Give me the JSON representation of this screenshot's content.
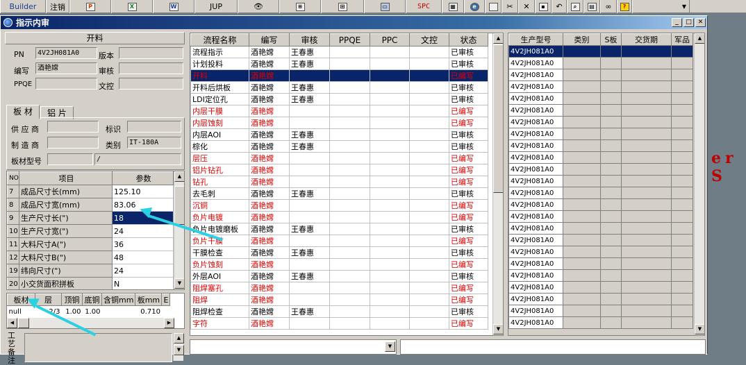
{
  "toolbar": {
    "builder": "Builder",
    "register": "注销",
    "jup": "JUP",
    "spc": "SPC"
  },
  "window": {
    "title": "指示内审"
  },
  "left": {
    "section_title": "开料",
    "pn_label": "PN",
    "pn_value": "4V2JH081A0",
    "version_label": "版本",
    "author_label": "编写",
    "author_value": "酒艳嫦",
    "review_label": "审核",
    "ppqe_label": "PPQE",
    "doc_control_label": "文控",
    "tab_board": "板 材",
    "tab_copper": "铝 片",
    "supplier_label": "供 应 商",
    "mark_label": "标识",
    "manufacturer_label": "制 造 商",
    "category_label": "类别",
    "category_value": "IT-180A",
    "board_model_label": "板材型号",
    "board_model_suffix": "/"
  },
  "params": {
    "headers": [
      "NO",
      "项目",
      "参数"
    ],
    "rows": [
      {
        "no": "7",
        "item": "成品尺寸长(mm)",
        "value": "125.10"
      },
      {
        "no": "8",
        "item": "成品尺寸宽(mm)",
        "value": "83.06"
      },
      {
        "no": "9",
        "item": "生产尺寸长(\")",
        "value": "18",
        "selected": true
      },
      {
        "no": "10",
        "item": "生产尺寸宽(\")",
        "value": "24"
      },
      {
        "no": "11",
        "item": "大料尺寸A(\")",
        "value": "36"
      },
      {
        "no": "12",
        "item": "大料尺寸B(\")",
        "value": "48"
      },
      {
        "no": "19",
        "item": "纬向尺寸(\")",
        "value": "24"
      },
      {
        "no": "20",
        "item": "小交货面积拼板",
        "value": "N"
      }
    ]
  },
  "layers": {
    "headers": [
      "板材",
      "层",
      "顶铜",
      "底铜",
      "含铜mm",
      "板mm",
      "E"
    ],
    "row": [
      "null",
      "2/3",
      "1.00",
      "1.00",
      "",
      "0.710",
      ""
    ]
  },
  "remark": {
    "label": "工艺备注"
  },
  "process": {
    "headers": [
      "流程名称",
      "编写",
      "审核",
      "PPQE",
      "PPC",
      "文控",
      "状态"
    ],
    "rows": [
      {
        "name": "流程指示",
        "author": "酒艳嫦",
        "reviewer": "王春惠",
        "status": "已审核",
        "red": false
      },
      {
        "name": "计划投料",
        "author": "酒艳嫦",
        "reviewer": "王春惠",
        "status": "已审核",
        "red": false
      },
      {
        "name": "开料",
        "author": "酒艳嫦",
        "reviewer": "",
        "status": "已编写",
        "red": true,
        "selected": true
      },
      {
        "name": "开料后烘板",
        "author": "酒艳嫦",
        "reviewer": "王春惠",
        "status": "已审核",
        "red": false
      },
      {
        "name": "LDI定位孔",
        "author": "酒艳嫦",
        "reviewer": "王春惠",
        "status": "已审核",
        "red": false
      },
      {
        "name": "内层干膜",
        "author": "酒艳嫦",
        "reviewer": "",
        "status": "已编写",
        "red": true
      },
      {
        "name": "内层蚀刻",
        "author": "酒艳嫦",
        "reviewer": "",
        "status": "已编写",
        "red": true
      },
      {
        "name": "内层AOI",
        "author": "酒艳嫦",
        "reviewer": "王春惠",
        "status": "已审核",
        "red": false
      },
      {
        "name": "棕化",
        "author": "酒艳嫦",
        "reviewer": "王春惠",
        "status": "已审核",
        "red": false
      },
      {
        "name": "层压",
        "author": "酒艳嫦",
        "reviewer": "",
        "status": "已编写",
        "red": true
      },
      {
        "name": "铝片钻孔",
        "author": "酒艳嫦",
        "reviewer": "",
        "status": "已编写",
        "red": true
      },
      {
        "name": "钻孔",
        "author": "酒艳嫦",
        "reviewer": "",
        "status": "已编写",
        "red": true
      },
      {
        "name": "去毛刺",
        "author": "酒艳嫦",
        "reviewer": "王春惠",
        "status": "已审核",
        "red": false
      },
      {
        "name": "沉铜",
        "author": "酒艳嫦",
        "reviewer": "",
        "status": "已编写",
        "red": true
      },
      {
        "name": "负片电镀",
        "author": "酒艳嫦",
        "reviewer": "",
        "status": "已编写",
        "red": true
      },
      {
        "name": "负片电镀磨板",
        "author": "酒艳嫦",
        "reviewer": "王春惠",
        "status": "已审核",
        "red": false
      },
      {
        "name": "负片干膜",
        "author": "酒艳嫦",
        "reviewer": "",
        "status": "已编写",
        "red": true
      },
      {
        "name": "干膜检查",
        "author": "酒艳嫦",
        "reviewer": "王春惠",
        "status": "已审核",
        "red": false
      },
      {
        "name": "负片蚀刻",
        "author": "酒艳嫦",
        "reviewer": "",
        "status": "已编写",
        "red": true
      },
      {
        "name": "外层AOI",
        "author": "酒艳嫦",
        "reviewer": "王春惠",
        "status": "已审核",
        "red": false
      },
      {
        "name": "阻焊塞孔",
        "author": "酒艳嫦",
        "reviewer": "",
        "status": "已编写",
        "red": true
      },
      {
        "name": "阻焊",
        "author": "酒艳嫦",
        "reviewer": "",
        "status": "已编写",
        "red": true
      },
      {
        "name": "阻焊检查",
        "author": "酒艳嫦",
        "reviewer": "王春惠",
        "status": "已审核",
        "red": false
      },
      {
        "name": "字符",
        "author": "酒艳嫦",
        "reviewer": "",
        "status": "已编写",
        "red": true
      }
    ]
  },
  "models": {
    "headers": [
      "生产型号",
      "类别",
      "S板",
      "交货期",
      "军品"
    ],
    "value": "4V2JH081A0",
    "count": 24
  },
  "background": {
    "text": "er S"
  },
  "colors": {
    "accent_arrow": "#2ad1e3",
    "selection": "#0a246a",
    "red_text": "#e00000"
  }
}
